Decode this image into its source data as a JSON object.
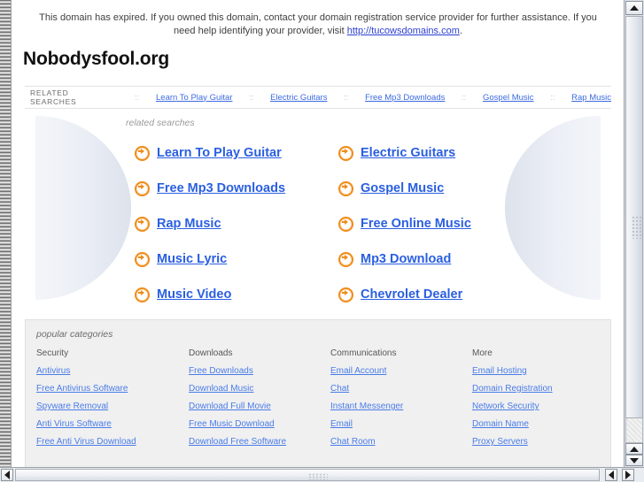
{
  "notice": {
    "text_before": "This domain has expired. If you owned this domain, contact your domain registration service provider for further assistance. If you need help identifying your provider, visit ",
    "link_text": "http://tucowsdomains.com",
    "text_after": "."
  },
  "brand": "Nobodysfool.org",
  "related_bar": {
    "label": "RELATED SEARCHES",
    "separator": "::",
    "links": [
      "Learn To Play Guitar",
      "Electric Guitars",
      "Free Mp3 Downloads",
      "Gospel Music",
      "Rap Music"
    ]
  },
  "main": {
    "caption": "related searches",
    "icon": "arrow-circle-right-icon",
    "links_left": [
      "Learn To Play Guitar",
      "Free Mp3 Downloads",
      "Rap Music",
      "Music Lyric",
      "Music Video"
    ],
    "links_right": [
      "Electric Guitars",
      "Gospel Music",
      "Free Online Music",
      "Mp3 Download",
      "Chevrolet Dealer"
    ]
  },
  "popular": {
    "title": "popular categories",
    "columns": [
      {
        "heading": "Security",
        "links": [
          "Antivirus",
          "Free Antivirus Software",
          "Spyware Removal",
          "Anti Virus Software",
          "Free Anti Virus Download"
        ]
      },
      {
        "heading": "Downloads",
        "links": [
          "Free Downloads",
          "Download Music",
          "Download Full Movie",
          "Free Music Download",
          "Download Free Software"
        ]
      },
      {
        "heading": "Communications",
        "links": [
          "Email Account",
          "Chat",
          "Instant Messenger",
          "Email",
          "Chat Room"
        ]
      },
      {
        "heading": "More",
        "links": [
          "Email Hosting",
          "Domain Registration",
          "Network Security",
          "Domain Name",
          "Proxy Servers"
        ]
      }
    ]
  },
  "colors": {
    "link_blue": "#2a5fe0",
    "nav_blue": "#3b6ae0",
    "arrow_orange": "#f08c1a",
    "panel_gray": "#f0f0f0"
  }
}
